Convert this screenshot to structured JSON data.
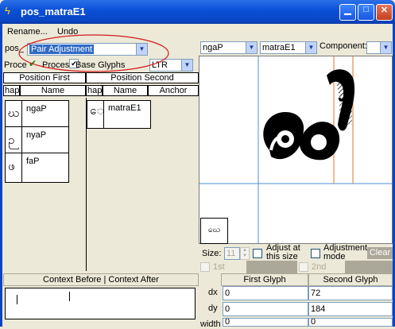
{
  "window": {
    "title": "pos_matraE1"
  },
  "menu": {
    "items": [
      "Rename...",
      "Undo"
    ]
  },
  "toolbar": {
    "pos_label": "pos_",
    "lookup_type": "Pair Adjustment",
    "process_label_1": "Proce",
    "process_label_2": "Proces",
    "base_glyphs_label": "Base Glyphs",
    "direction": "LTR"
  },
  "left_table": {
    "position_first_header": "Position First",
    "position_second_header": "Position Second",
    "col_shape": "hap",
    "col_name": "Name",
    "col_shape_2": "hap",
    "col_name_2": "Name",
    "col_anchor": "Anchor",
    "first_rows": [
      {
        "glyph": "ဃ",
        "name": "ngaP"
      },
      {
        "glyph": "ဉ",
        "name": "nyaP"
      },
      {
        "glyph": "ဖ",
        "name": "faP"
      }
    ],
    "second_rows": [
      {
        "glyph": "ေ",
        "name": "matraE1"
      }
    ]
  },
  "context": {
    "header": "Context Before | Context After"
  },
  "preview": {
    "glyph1_select": "ngaP",
    "glyph2_select": "matraE1",
    "component_label": "Component:",
    "component_value": "",
    "thumb_glyph": "ဃေ",
    "size_label": "Size:",
    "size_value": "11",
    "adjust_label": "Adjust at this size",
    "adjust_mode_label": "Adjustment mode",
    "clear_button": "Clear",
    "first_label": "1st",
    "second_label": "2nd"
  },
  "metrics": {
    "first_glyph_header": "First Glyph",
    "second_glyph_header": "Second Glyph",
    "rows": [
      {
        "label": "dx",
        "first": "0",
        "second": "72"
      },
      {
        "label": "dy",
        "first": "0",
        "second": "184"
      },
      {
        "label": "width",
        "first": "0",
        "second": "0"
      }
    ]
  }
}
